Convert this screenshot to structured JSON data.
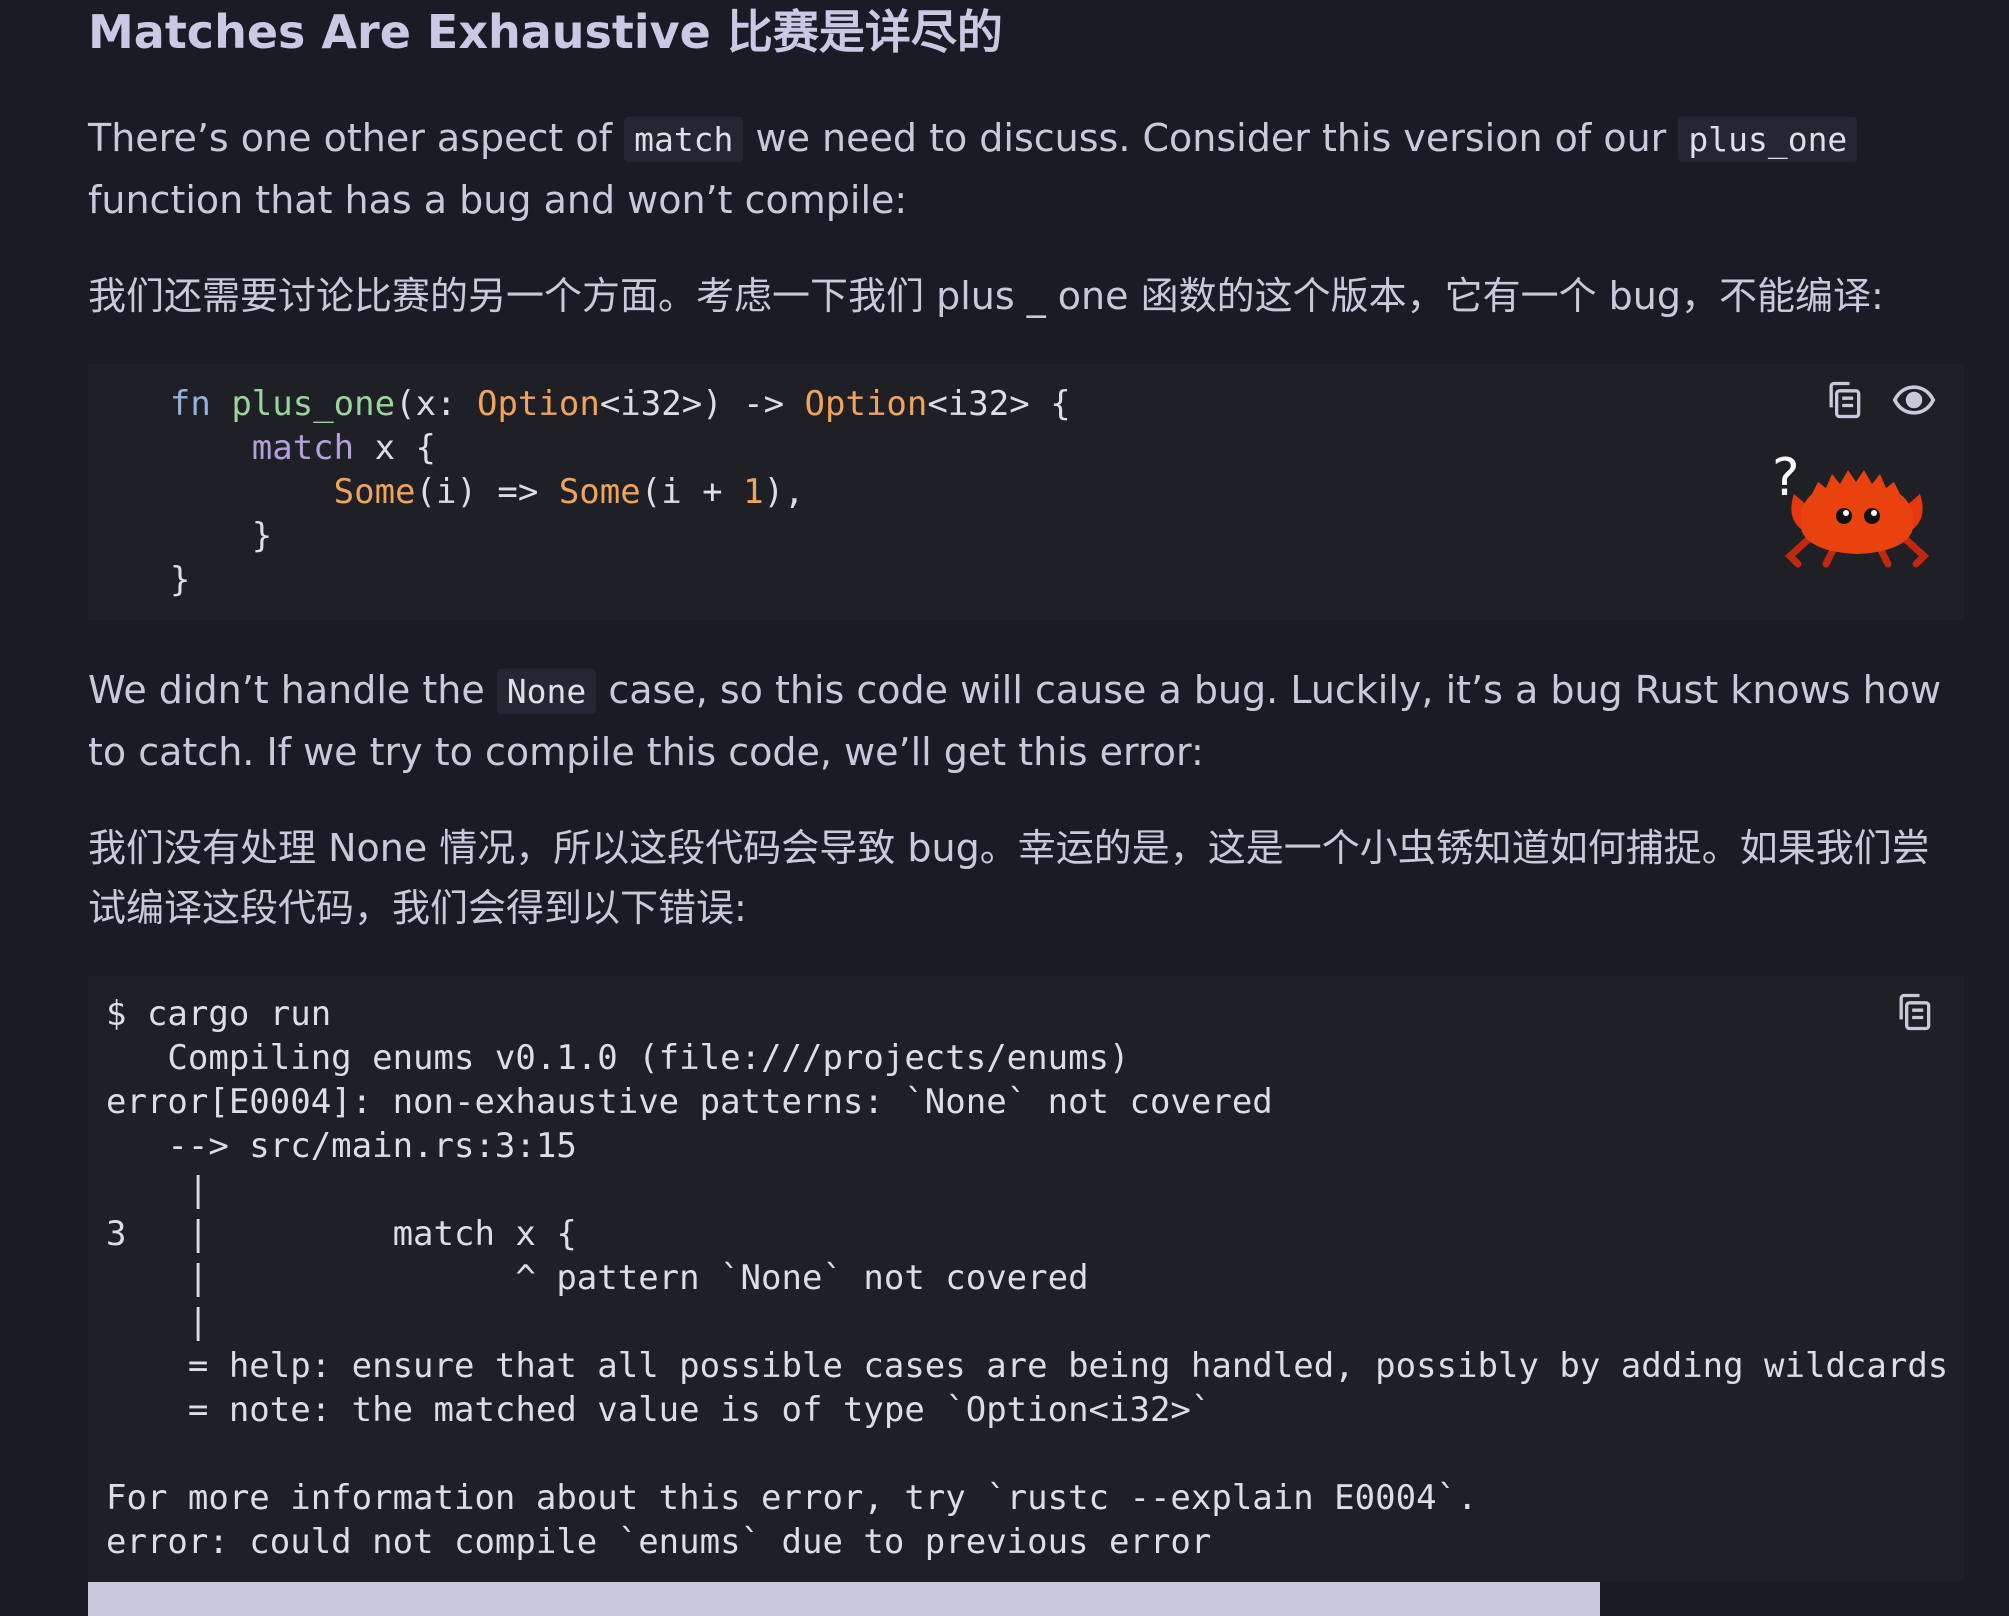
{
  "heading": "Matches Are Exhaustive 比赛是详尽的",
  "para1": {
    "t1": "There’s one other aspect of ",
    "code1": "match",
    "t2": " we need to discuss. Consider this version of our ",
    "code2": "plus_one",
    "t3": " function that has a bug and won’t compile:"
  },
  "para1_zh": "我们还需要讨论比赛的另一个方面。考虑一下我们 plus _ one 函数的这个版本，它有一个 bug，不能编译:",
  "code1": {
    "line1": {
      "fn": "fn",
      "name": "plus_one",
      "open": "(x: ",
      "type1": "Option",
      "gen1": "<i32>",
      "arrow": ") -> ",
      "type2": "Option",
      "gen2": "<i32>",
      "brace": " {"
    },
    "line2": {
      "kw": "match",
      "rest": " x {"
    },
    "line3": {
      "some1": "Some",
      "mid": "(i) => ",
      "some2": "Some",
      "paren": "(i + ",
      "num": "1",
      "end": "),"
    },
    "line4": "}",
    "line5": "}",
    "copy_icon": "copy-icon",
    "eye_icon": "eye-icon",
    "crab_mark": "?"
  },
  "para2": {
    "t1": "We didn’t handle the ",
    "code1": "None",
    "t2": " case, so this code will cause a bug. Luckily, it’s a bug Rust knows how to catch. If we try to compile this code, we’ll get this error:"
  },
  "para2_zh": "我们没有处理 None 情况，所以这段代码会导致 bug。幸运的是，这是一个小虫锈知道如何捕捉。如果我们尝试编译这段代码，我们会得到以下错误:",
  "output": {
    "lines": [
      "$ cargo run",
      "   Compiling enums v0.1.0 (file:///projects/enums)",
      "error[E0004]: non-exhaustive patterns: `None` not covered",
      "   --> src/main.rs:3:15",
      "    |",
      "3   |         match x {",
      "    |               ^ pattern `None` not covered",
      "    |",
      "    = help: ensure that all possible cases are being handled, possibly by adding wildcards or more match arms",
      "    = note: the matched value is of type `Option<i32>`",
      "",
      "For more information about this error, try `rustc --explain E0004`.",
      "error: could not compile `enums` due to previous error"
    ],
    "copy_icon": "copy-icon"
  }
}
